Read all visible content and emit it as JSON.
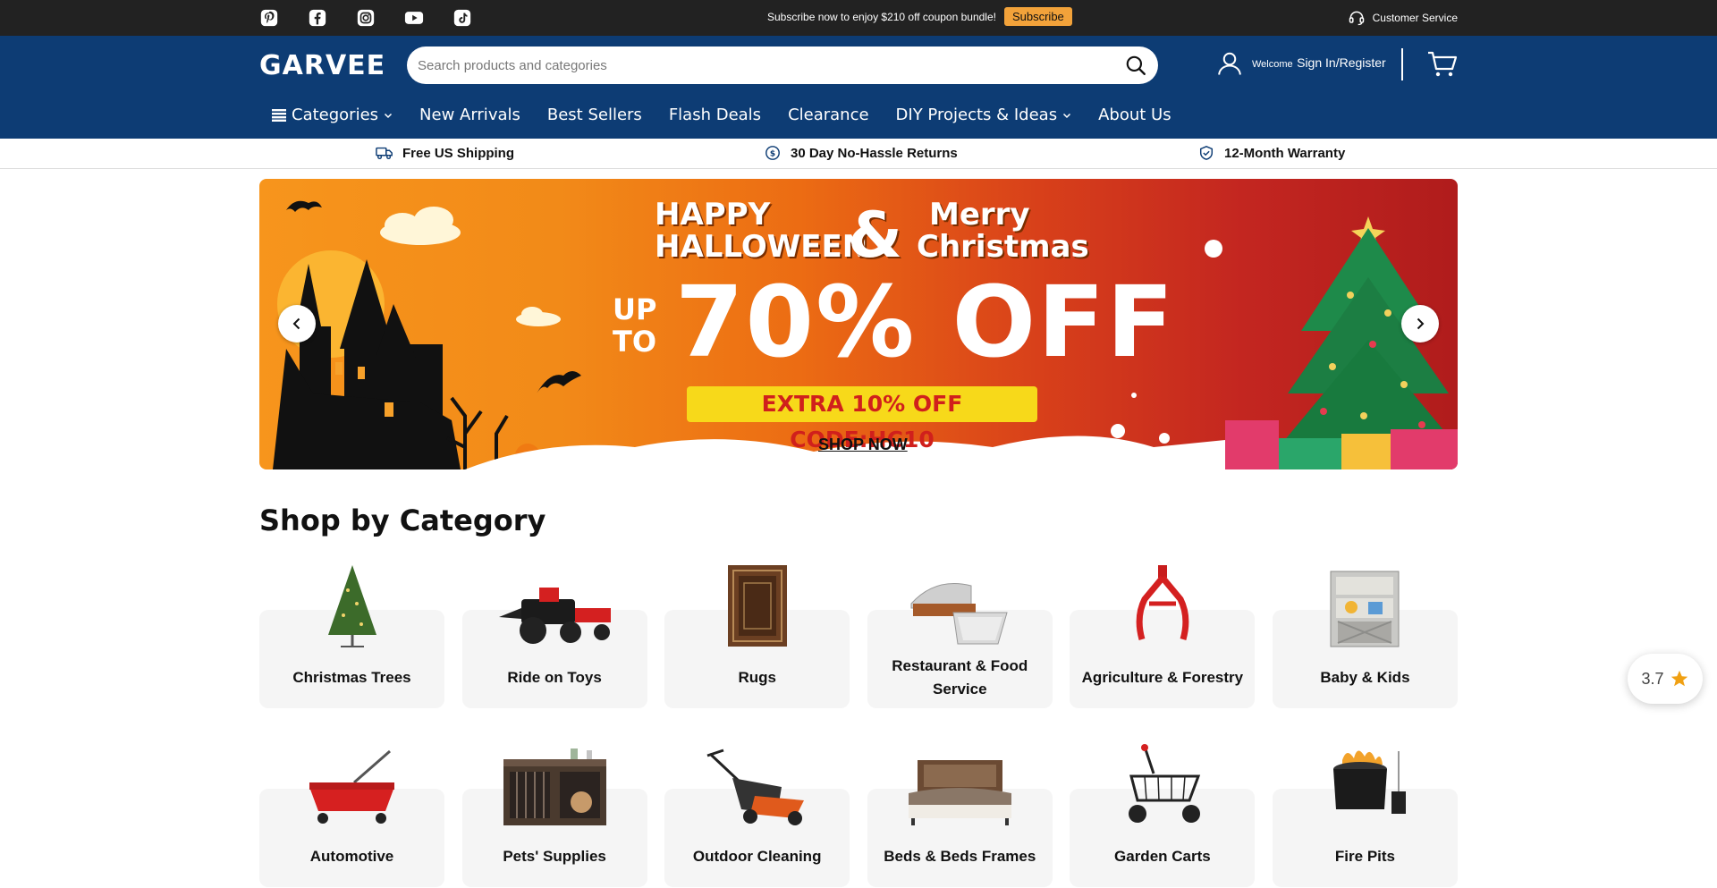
{
  "topbar": {
    "socials": [
      "pinterest-icon",
      "facebook-icon",
      "instagram-icon",
      "youtube-icon",
      "tiktok-icon"
    ],
    "promo_text": "Subscribe now to enjoy $210 off coupon bundle!",
    "subscribe_label": "Subscribe",
    "customer_service": "Customer Service"
  },
  "header": {
    "logo": "GARVEE",
    "search_placeholder": "Search products and categories",
    "welcome": "Welcome",
    "signin": "Sign In/Register"
  },
  "nav": {
    "items": [
      "Categories",
      "New Arrivals",
      "Best Sellers",
      "Flash Deals",
      "Clearance",
      "DIY Projects & Ideas",
      "About Us"
    ]
  },
  "benefits": [
    "Free US Shipping",
    "30 Day No-Hassle Returns",
    "12-Month Warranty"
  ],
  "banner": {
    "line1a": "HAPPY",
    "line1b": "HALLOWEEN",
    "amp": "&",
    "line2a": "Merry",
    "line2b": "Christmas",
    "upto_a": "UP",
    "upto_b": "TO",
    "big": "70% OFF",
    "code": "EXTRA 10% OFF CODE:HC10",
    "shop": "SHOP NOW"
  },
  "categories": {
    "title": "Shop by Category",
    "items": [
      "Christmas Trees",
      "Ride on Toys",
      "Rugs",
      "Restaurant & Food Service",
      "Agriculture & Forestry",
      "Baby & Kids",
      "Automotive",
      "Pets' Supplies",
      "Outdoor Cleaning",
      "Beds & Beds Frames",
      "Garden Carts",
      "Fire Pits"
    ]
  },
  "rating": {
    "value": "3.7"
  },
  "colors": {
    "topbar": "#222222",
    "header": "#0d3c74",
    "subscribe": "#f2a23a",
    "code_bg": "#f7d91a"
  }
}
